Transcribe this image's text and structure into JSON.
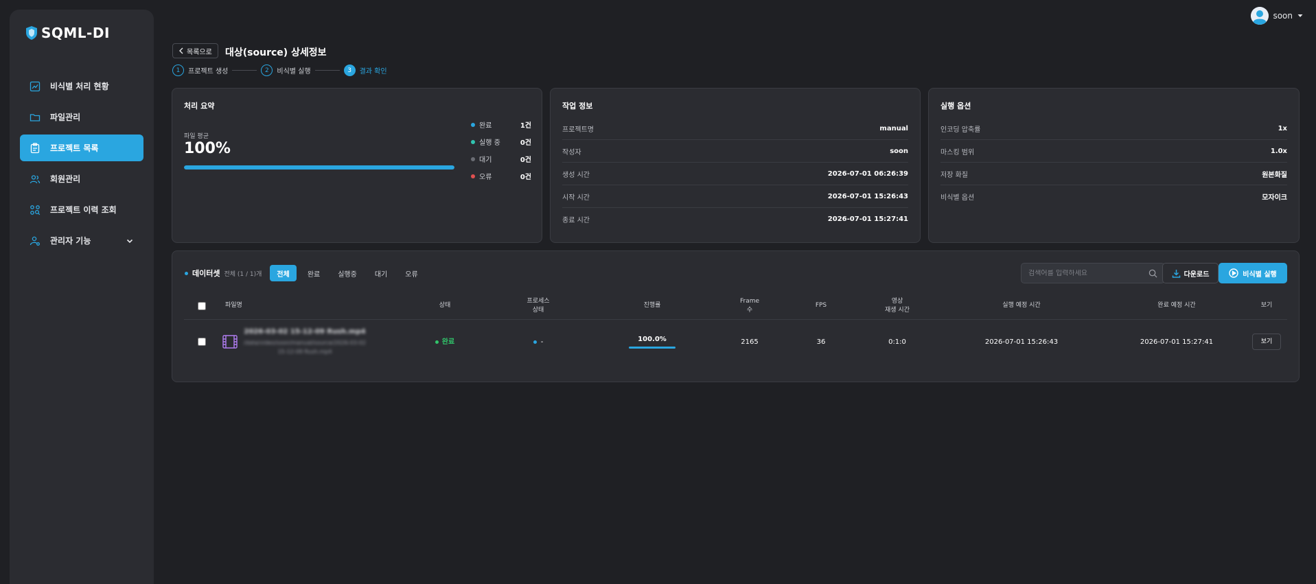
{
  "app": {
    "logo_text": "SQML-DI"
  },
  "user": {
    "name": "soon"
  },
  "sidebar": {
    "items": [
      {
        "label": "비식별 처리 현황",
        "icon": "chart-line-icon"
      },
      {
        "label": "파일관리",
        "icon": "folder-icon"
      },
      {
        "label": "프로젝트 목록",
        "icon": "clipboard-icon",
        "active": true
      },
      {
        "label": "회원관리",
        "icon": "users-icon"
      },
      {
        "label": "프로젝트 이력 조회",
        "icon": "search-history-icon"
      },
      {
        "label": "관리자 기능",
        "icon": "admin-user-icon",
        "has_submenu": true
      }
    ]
  },
  "header": {
    "back_label": "목록으로",
    "title": "대상(source) 상세정보",
    "steps": [
      {
        "num": "1",
        "label": "프로젝트 생성"
      },
      {
        "num": "2",
        "label": "비식별 실행"
      },
      {
        "num": "3",
        "label": "결과 확인",
        "active": true
      }
    ]
  },
  "summary": {
    "title": "처리 요약",
    "avg_label": "파일 평균",
    "avg_value": "100%",
    "avg_progress": 1.0,
    "legend": [
      {
        "label": "완료",
        "count": "1건",
        "color": "#2aa6e0"
      },
      {
        "label": "실행 중",
        "count": "0건",
        "color": "#31c4b0"
      },
      {
        "label": "대기",
        "count": "0건",
        "color": "#6b6d74"
      },
      {
        "label": "오류",
        "count": "0건",
        "color": "#e05050"
      }
    ]
  },
  "job_info": {
    "title": "작업 정보",
    "rows": [
      {
        "k": "프로젝트명",
        "v": "manual"
      },
      {
        "k": "작성자",
        "v": "soon"
      },
      {
        "k": "생성 시간",
        "v": "2026-07-01 06:26:39"
      },
      {
        "k": "시작 시간",
        "v": "2026-07-01 15:26:43"
      },
      {
        "k": "종료 시간",
        "v": "2026-07-01 15:27:41"
      }
    ]
  },
  "run_options": {
    "title": "실행 옵션",
    "rows": [
      {
        "k": "인코딩 압축률",
        "v": "1x"
      },
      {
        "k": "마스킹 범위",
        "v": "1.0x"
      },
      {
        "k": "저장 화질",
        "v": "원본화질"
      },
      {
        "k": "비식별 옵션",
        "v": "모자이크"
      }
    ]
  },
  "dataset": {
    "title": "데이터셋",
    "count": "전체 (1 / 1)개",
    "tabs": [
      "전체",
      "완료",
      "실행중",
      "대기",
      "오류"
    ],
    "search_placeholder": "검색어를 입력하세요",
    "download_label": "다운로드",
    "run_label": "비식별 실행",
    "columns": {
      "filename": "파일명",
      "status": "상태",
      "process": "프로세스\n상태",
      "progress": "진행률",
      "frames": "Frame\n수",
      "fps": "FPS",
      "duration": "영상\n재생 시간",
      "start_eta": "실행 예정 시간",
      "end_eta": "완료 예정 시간",
      "view": "보기"
    },
    "rows": [
      {
        "filename": "2026-03-02 15-12-09 Rush.mp4",
        "filepath": "/data/video/soon/manual/source/2026-03-02 15-12-09 Rush.mp4",
        "status": "완료",
        "process": "-",
        "progress": "100.0%",
        "progress_value": 1.0,
        "frames": "2165",
        "fps": "36",
        "duration": "0:1:0",
        "start_eta": "2026-07-01 15:26:43",
        "end_eta": "2026-07-01 15:27:41",
        "view_label": "보기"
      }
    ]
  }
}
